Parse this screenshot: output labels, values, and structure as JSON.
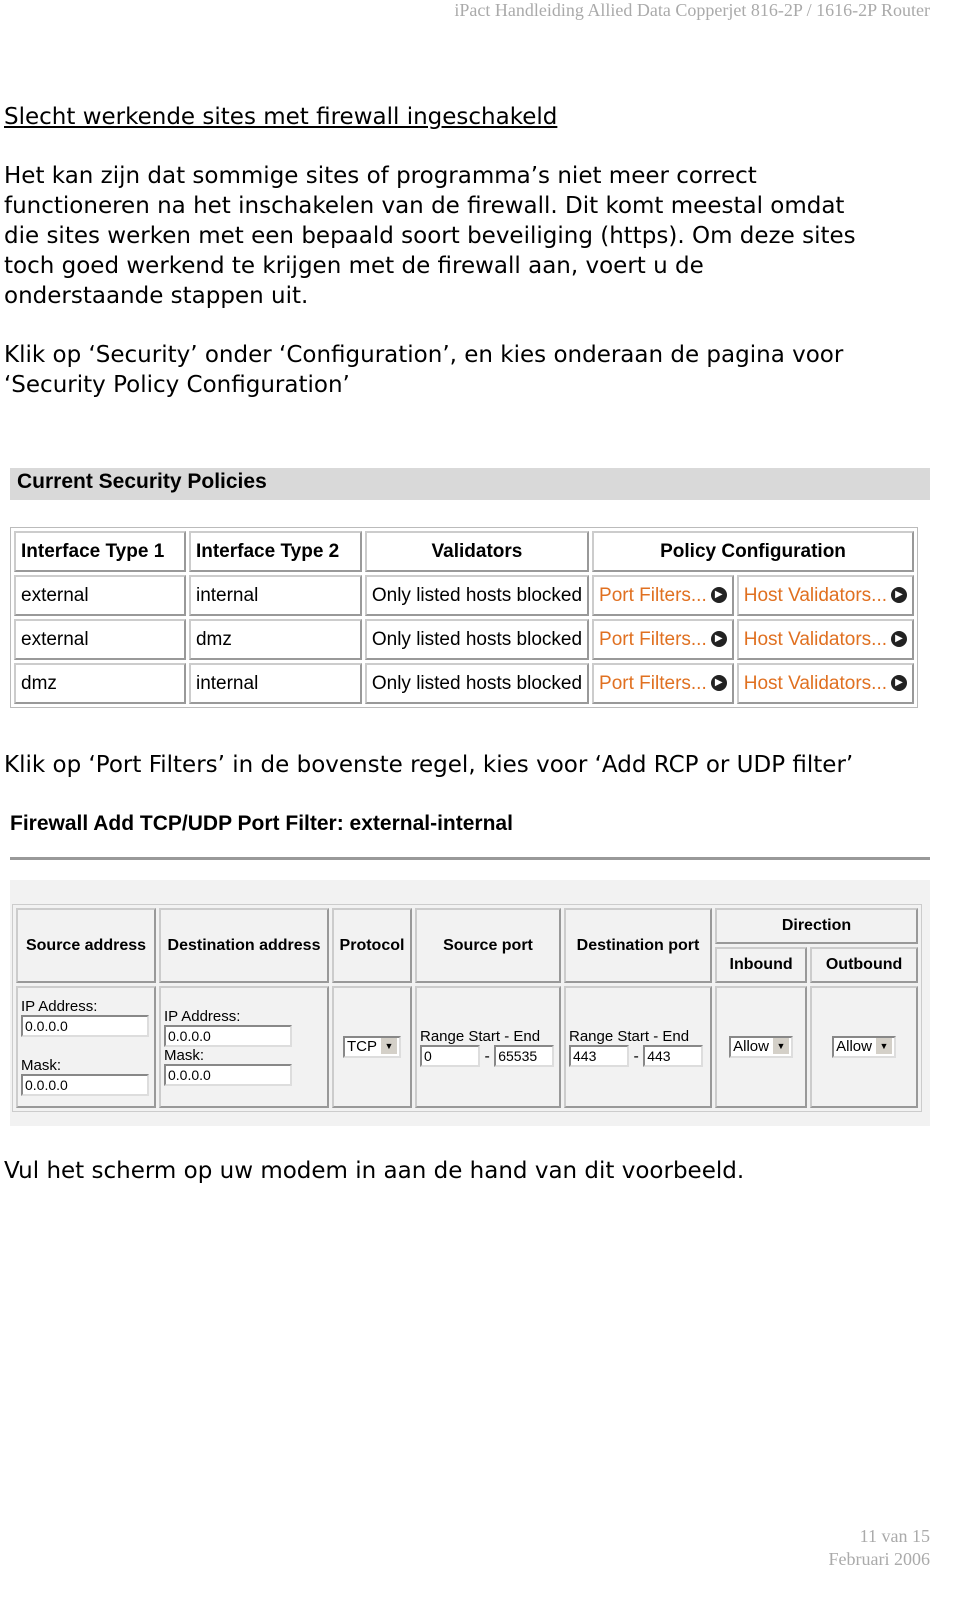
{
  "header": "iPact Handleiding Allied Data Copperjet 816-2P / 1616-2P Router",
  "title": "Slecht werkende sites met firewall ingeschakeld",
  "para1": [
    "Het kan zijn dat sommige sites of programma’s niet meer correct",
    "functioneren na het inschakelen van de firewall. Dit komt meestal omdat",
    "die sites werken met een bepaald soort beveiliging (https). Om deze sites",
    "toch goed werkend te krijgen met de firewall aan, voert u de",
    "onderstaande stappen uit."
  ],
  "para2": [
    "Klik op ‘Security’ onder ‘Configuration’, en kies onderaan de pagina voor",
    "‘Security Policy Configuration’"
  ],
  "policies": {
    "title": "Current Security Policies",
    "headers": [
      "Interface Type 1",
      "Interface Type 2",
      "Validators",
      "Policy Configuration"
    ],
    "rows": [
      [
        "external",
        "internal",
        "Only listed hosts blocked",
        "Port Filters...",
        "Host Validators..."
      ],
      [
        "external",
        "dmz",
        "Only listed hosts blocked",
        "Port Filters...",
        "Host Validators..."
      ],
      [
        "dmz",
        "internal",
        "Only listed hosts blocked",
        "Port Filters...",
        "Host Validators..."
      ]
    ],
    "link_color": "#e07020",
    "arrow_icon": "circle-arrow-right"
  },
  "para3": "Klik op ‘Port Filters’ in de bovenste regel, kies voor ‘Add RCP or UDP filter’",
  "filter": {
    "title": "Firewall Add TCP/UDP Port Filter: external-internal",
    "headers": {
      "source": "Source address",
      "dest": "Destination address",
      "protocol": "Protocol",
      "sport": "Source port",
      "dport": "Destination port",
      "direction": "Direction",
      "inbound": "Inbound",
      "outbound": "Outbound"
    },
    "ip_label": "IP Address:",
    "mask_label": "Mask:",
    "range_label": "Range Start - End",
    "dash": "-",
    "src_ip": "0.0.0.0",
    "src_mask": "0.0.0.0",
    "dst_ip": "0.0.0.0",
    "dst_mask": "0.0.0.0",
    "protocol": "TCP",
    "sport_start": "0",
    "sport_end": "65535",
    "dport_start": "443",
    "dport_end": "443",
    "inbound": "Allow",
    "outbound": "Allow"
  },
  "para4": "Vul het scherm op uw modem in aan de hand van dit voorbeeld.",
  "footer": {
    "page": "11 van 15",
    "date": "Februari 2006"
  }
}
